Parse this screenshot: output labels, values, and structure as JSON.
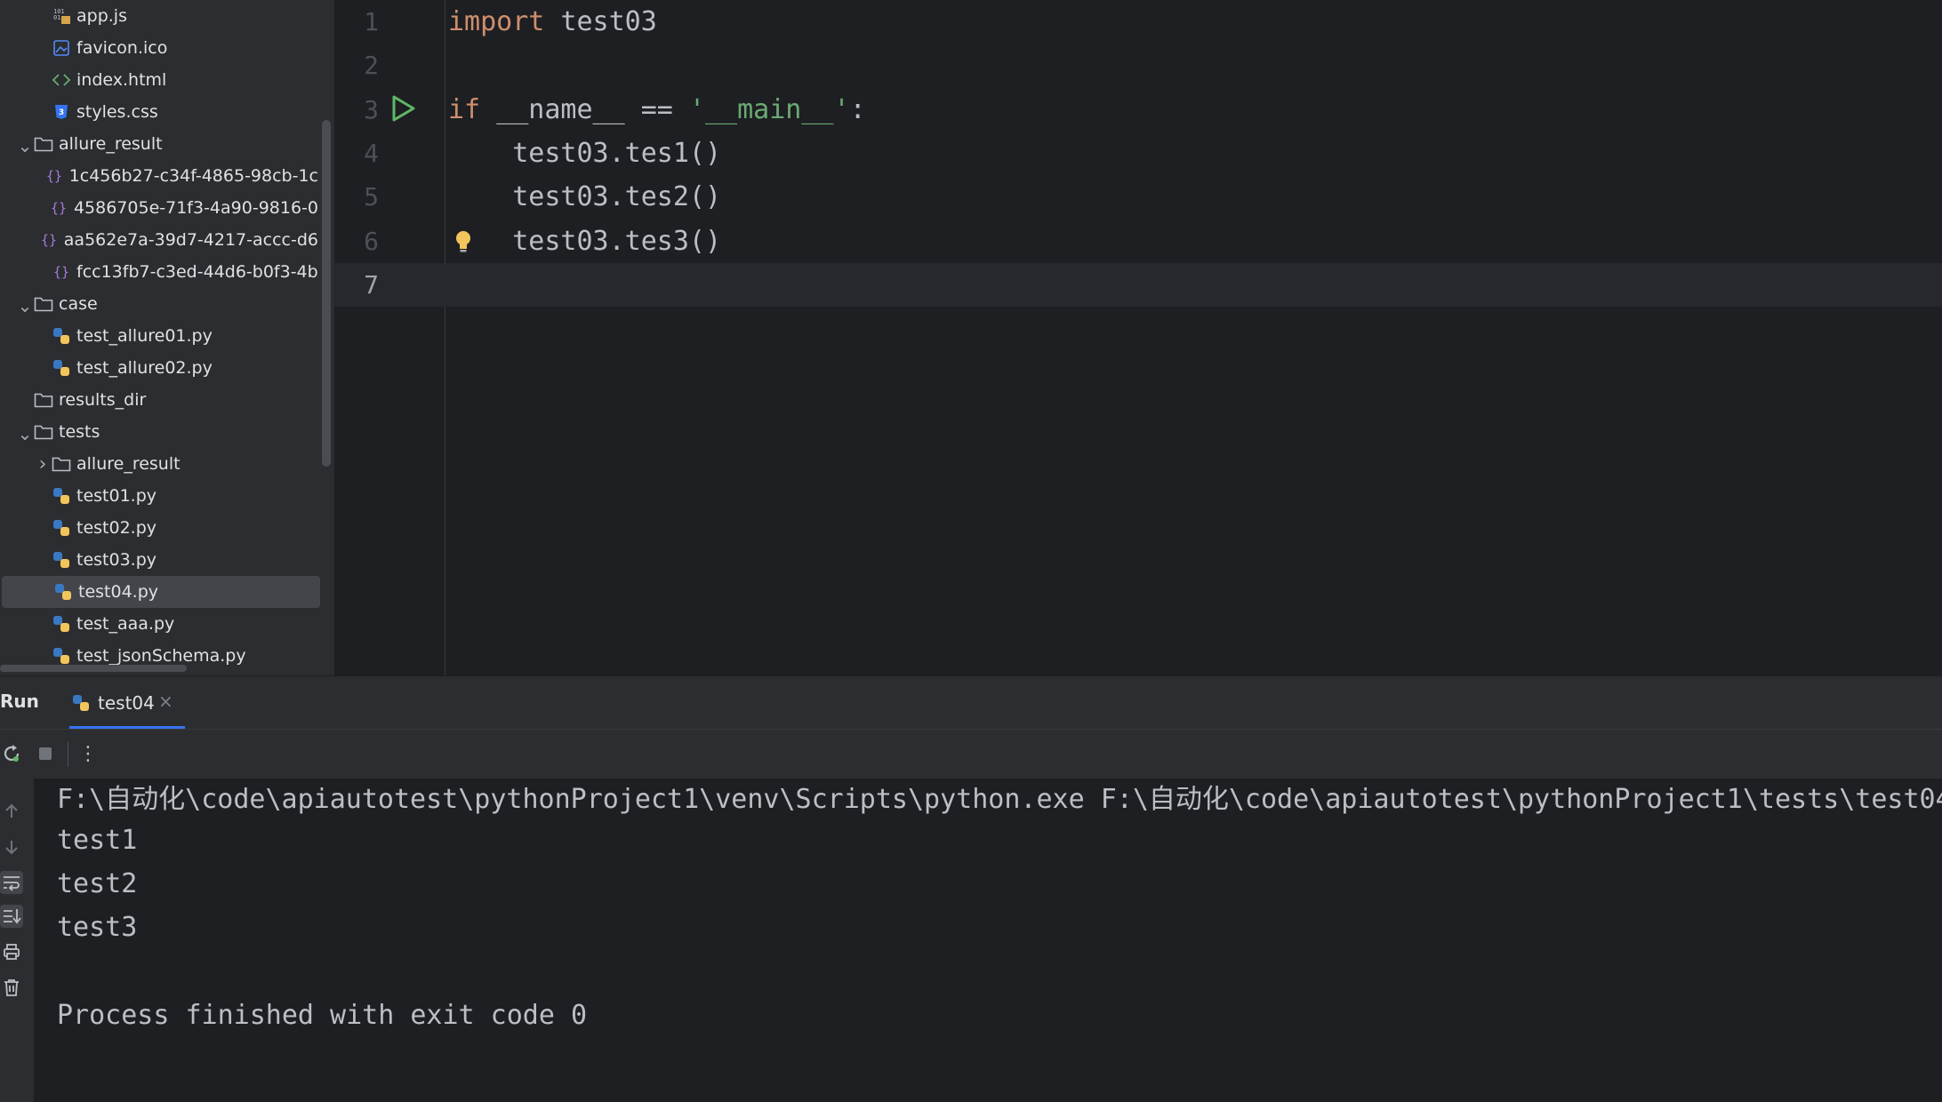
{
  "tree": {
    "items": [
      {
        "label": "app.js",
        "type": "js",
        "depth": 2
      },
      {
        "label": "favicon.ico",
        "type": "image",
        "depth": 2
      },
      {
        "label": "index.html",
        "type": "html",
        "depth": 2
      },
      {
        "label": "styles.css",
        "type": "css",
        "depth": 2
      },
      {
        "label": "allure_result",
        "type": "folder",
        "depth": 1,
        "expanded": true
      },
      {
        "label": "1c456b27-c34f-4865-98cb-1c",
        "type": "json",
        "depth": 2
      },
      {
        "label": "4586705e-71f3-4a90-9816-0",
        "type": "json",
        "depth": 2
      },
      {
        "label": "aa562e7a-39d7-4217-accc-d6",
        "type": "json",
        "depth": 2
      },
      {
        "label": "fcc13fb7-c3ed-44d6-b0f3-4b",
        "type": "json",
        "depth": 2
      },
      {
        "label": "case",
        "type": "folder",
        "depth": 1,
        "expanded": true
      },
      {
        "label": "test_allure01.py",
        "type": "python",
        "depth": 2
      },
      {
        "label": "test_allure02.py",
        "type": "python",
        "depth": 2
      },
      {
        "label": "results_dir",
        "type": "folder",
        "depth": 1,
        "expanded": null
      },
      {
        "label": "tests",
        "type": "folder",
        "depth": 1,
        "expanded": true
      },
      {
        "label": "allure_result",
        "type": "folder",
        "depth": 2,
        "expanded": false
      },
      {
        "label": "test01.py",
        "type": "python",
        "depth": 2
      },
      {
        "label": "test02.py",
        "type": "python",
        "depth": 2
      },
      {
        "label": "test03.py",
        "type": "python",
        "depth": 2
      },
      {
        "label": "test04.py",
        "type": "python",
        "depth": 2,
        "selected": true
      },
      {
        "label": "test_aaa.py",
        "type": "python",
        "depth": 2
      },
      {
        "label": "test_jsonSchema.py",
        "type": "python",
        "depth": 2
      }
    ]
  },
  "editor": {
    "lines": [
      {
        "num": "1",
        "tokens": [
          {
            "t": "import ",
            "c": "kw"
          },
          {
            "t": "test03",
            "c": ""
          }
        ]
      },
      {
        "num": "2",
        "tokens": []
      },
      {
        "num": "3",
        "tokens": [
          {
            "t": "if ",
            "c": "kw"
          },
          {
            "t": "__name__ == ",
            "c": ""
          },
          {
            "t": "'__main__'",
            "c": "str"
          },
          {
            "t": ":",
            "c": ""
          }
        ]
      },
      {
        "num": "4",
        "tokens": [
          {
            "t": "    test03.tes1()",
            "c": ""
          }
        ]
      },
      {
        "num": "5",
        "tokens": [
          {
            "t": "    test03.tes2()",
            "c": ""
          }
        ]
      },
      {
        "num": "6",
        "tokens": [
          {
            "t": "    test03.tes3()",
            "c": ""
          }
        ]
      },
      {
        "num": "7",
        "tokens": [],
        "current": true
      }
    ],
    "run_gutter_icon": "run-triangle-icon",
    "hint_icon": "lightbulb-icon"
  },
  "run": {
    "title": "Run",
    "tab_label": "test04",
    "tab_close": "×",
    "more_label": "⋮",
    "console": [
      "F:\\自动化\\code\\apiautotest\\pythonProject1\\venv\\Scripts\\python.exe F:\\自动化\\code\\apiautotest\\pythonProject1\\tests\\test04",
      "test1",
      "test2",
      "test3",
      "",
      "Process finished with exit code 0"
    ]
  },
  "colors": {
    "keyword": "#cf8e6d",
    "string": "#6aab73",
    "accent": "#3574f0",
    "run_green": "#5fb865"
  }
}
